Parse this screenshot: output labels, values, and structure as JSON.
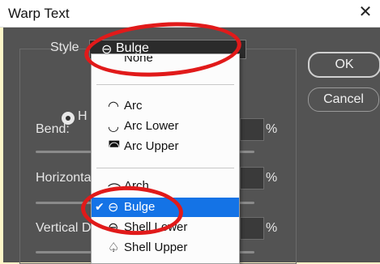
{
  "window": {
    "title": "Warp Text",
    "close_glyph": "✕"
  },
  "form": {
    "style_label": "Style",
    "style_value": "Bulge",
    "orientation_label": "H",
    "bend_label": "Bend:",
    "horizontal_label": "Horizonta",
    "vertical_label": "Vertical D",
    "percent": "%"
  },
  "buttons": {
    "ok": "OK",
    "cancel": "Cancel"
  },
  "dropdown": {
    "items": [
      {
        "label": "None",
        "icon": "none-icon",
        "glyph": ""
      },
      {
        "label": "Arc",
        "icon": "arc-icon",
        "glyph": "◠"
      },
      {
        "label": "Arc Lower",
        "icon": "arc-lower-icon",
        "glyph": "◡"
      },
      {
        "label": "Arc Upper",
        "icon": "arc-upper-icon",
        "glyph": "◚"
      },
      {
        "label": "Arch",
        "icon": "arch-icon",
        "glyph": "⌒"
      },
      {
        "label": "Bulge",
        "icon": "bulge-icon",
        "glyph": "⊖",
        "selected": true
      },
      {
        "label": "Shell Lower",
        "icon": "shell-lower-icon",
        "glyph": "⊖"
      },
      {
        "label": "Shell Upper",
        "icon": "shell-upper-icon",
        "glyph": "♤"
      }
    ]
  },
  "colors": {
    "dialog_bg": "#535353",
    "highlight": "#1473e6",
    "annotation": "#e11a1a",
    "backdrop": "#fdf6c8"
  }
}
